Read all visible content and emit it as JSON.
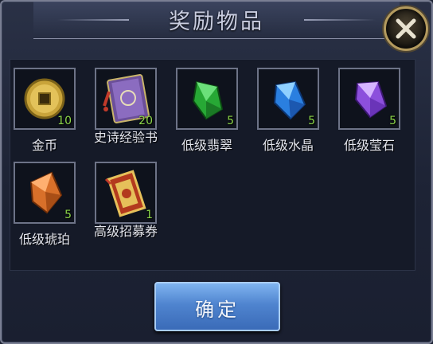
{
  "dialog": {
    "title": "奖励物品",
    "close_icon": "close-x-icon",
    "confirm_label": "确定"
  },
  "items": [
    {
      "name": "金币",
      "quantity": "10",
      "icon": "gold-coin-icon"
    },
    {
      "name": "史诗经验书",
      "quantity": "20",
      "icon": "epic-exp-book-icon"
    },
    {
      "name": "低级翡翠",
      "quantity": "5",
      "icon": "emerald-gem-icon"
    },
    {
      "name": "低级水晶",
      "quantity": "5",
      "icon": "crystal-gem-icon"
    },
    {
      "name": "低级莹石",
      "quantity": "5",
      "icon": "fluorite-gem-icon"
    },
    {
      "name": "低级琥珀",
      "quantity": "5",
      "icon": "amber-gem-icon"
    },
    {
      "name": "高级招募券",
      "quantity": "1",
      "icon": "recruit-ticket-icon"
    }
  ],
  "colors": {
    "quantity": "#8bd64a",
    "emerald": "#2fbf3a",
    "crystal": "#2e8ef0",
    "fluorite": "#9a5ae6",
    "amber": "#e07a2e"
  }
}
